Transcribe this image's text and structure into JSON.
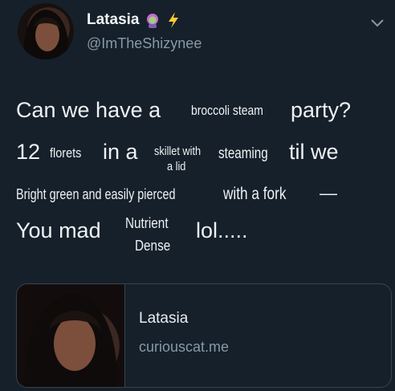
{
  "tweet": {
    "display_name": "Latasia",
    "name_emojis": [
      "woman-zombie-icon",
      "lightning-icon"
    ],
    "handle": "@ImTheShizynee",
    "lines": {
      "l1a": "Can we have a",
      "l1b": "broccoli steam",
      "l1c": "party?",
      "l2a": "12",
      "l2b": "florets",
      "l2c": "in a",
      "l2d": "skillet with",
      "l2e": "a lid",
      "l2f": "steaming",
      "l2g": "til we",
      "l3a": "Bright green and easily pierced",
      "l3b": "with a fork",
      "l3c": "—",
      "l4a": "You mad",
      "l4b": "Nutrient",
      "l4c": "Dense",
      "l4d": "lol....."
    }
  },
  "card": {
    "title": "Latasia",
    "domain": "curiouscat.me"
  },
  "colors": {
    "background": "#15202b",
    "text": "#eef1f3",
    "secondary": "#8899a6",
    "border": "#38444d"
  }
}
